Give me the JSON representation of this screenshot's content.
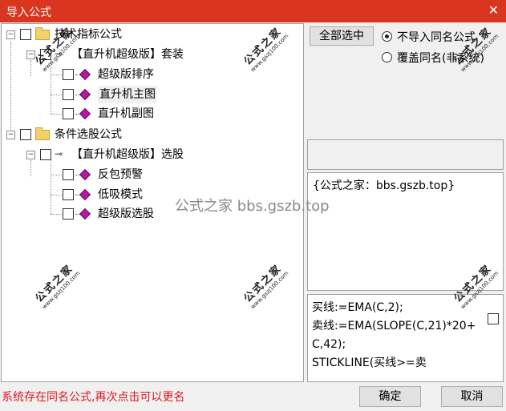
{
  "window": {
    "title": "导入公式",
    "close_icon": "close-icon"
  },
  "tree": {
    "groups": [
      {
        "label": "技术指标公式",
        "subgroups": [
          {
            "label": "【直升机超级版】套装",
            "items": [
              "超级版排序",
              "直升机主图",
              "直升机副图"
            ]
          }
        ]
      },
      {
        "label": "条件选股公式",
        "subgroups": [
          {
            "label": "【直升机超级版】选股",
            "items": [
              "反包预警",
              "低吸模式",
              "超级版选股"
            ]
          }
        ]
      }
    ],
    "selected_item": "直升机主图"
  },
  "options": {
    "select_all_label": "全部选中",
    "radio_skip_label": "不导入同名公式",
    "radio_overwrite_label": "覆盖同名(非系统)",
    "selected": "skip"
  },
  "name_box": {
    "value": ""
  },
  "description": {
    "text": "{公式之家：bbs.gszb.top}"
  },
  "code": {
    "text": "买线:=EMA(C,2);\n卖线:=EMA(SLOPE(C,21)*20+C,42);\nSTICKLINE(买线>=卖"
  },
  "status": {
    "message": "系统存在同名公式,再次点击可以更名"
  },
  "buttons": {
    "ok_label": "确定",
    "cancel_label": "取消"
  },
  "watermark": {
    "center_text": "公式之家 bbs.gszb.top",
    "stamp_text": "公式之家",
    "stamp_url": "www.gszj100.com"
  },
  "colors": {
    "titlebar": "#d9351f",
    "status_text": "#e0161d",
    "formula_icon": "#b01aa0",
    "folder": "#f4d06b"
  }
}
